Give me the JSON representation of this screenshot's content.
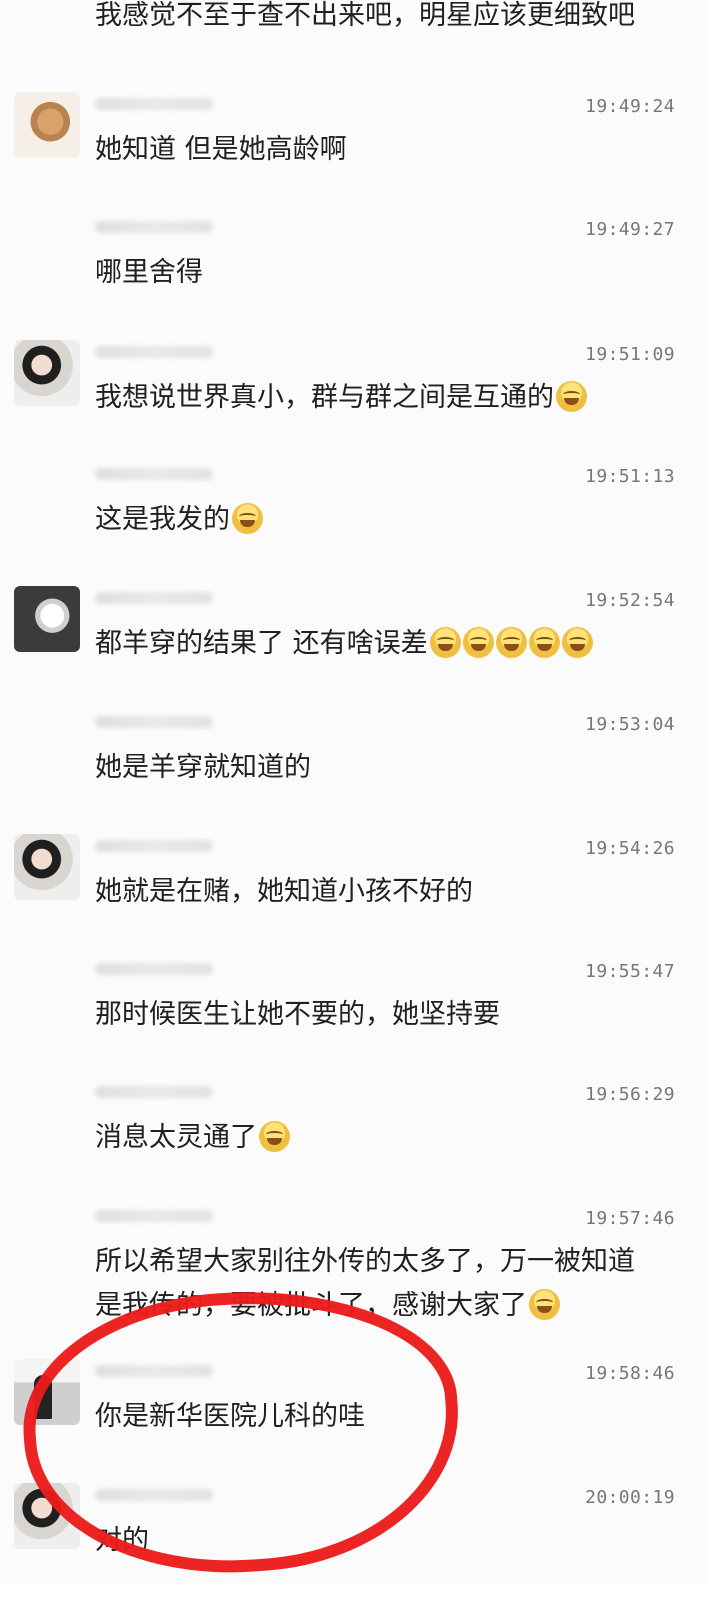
{
  "chat": {
    "top_line": "我感觉不至于查不出来吧，明星应该更细致吧",
    "messages": [
      {
        "time": "19:49:24",
        "text": "她知道 但是她高龄啊",
        "avatar": "cat"
      },
      {
        "time": "19:49:27",
        "text": "哪里舍得",
        "avatar": "blank"
      },
      {
        "time": "19:51:09",
        "text": "我想说世界真小，群与群之间是互通的",
        "avatar": "girl",
        "emoji": "laughing-tears-face"
      },
      {
        "time": "19:51:13",
        "text": "这是我发的",
        "avatar": "blank",
        "emoji": "laughing-face"
      },
      {
        "time": "19:52:54",
        "text": "都羊穿的结果了 还有啥误差",
        "avatar": "dog",
        "emoji_count": 5
      },
      {
        "time": "19:53:04",
        "text": "她是羊穿就知道的",
        "avatar": "blank"
      },
      {
        "time": "19:54:26",
        "text": "她就是在赌，她知道小孩不好的",
        "avatar": "girl"
      },
      {
        "time": "19:55:47",
        "text": "那时候医生让她不要的，她坚持要",
        "avatar": "blank"
      },
      {
        "time": "19:56:29",
        "text": "消息太灵通了",
        "avatar": "blank",
        "emoji": "laughing-face"
      },
      {
        "time": "19:57:46",
        "text": "所以希望大家别往外传的太多了，万一被知道\n是我传的，要被批斗了，感谢大家了",
        "avatar": "blank",
        "emoji": "laughing-tears-face"
      },
      {
        "time": "19:58:46",
        "text": "你是新华医院儿科的哇",
        "avatar": "hospital"
      },
      {
        "time": "20:00:19",
        "text": "对的",
        "avatar": "girl"
      }
    ]
  },
  "colors": {
    "background": "#fbfbfb",
    "text": "#202020",
    "time": "#777777",
    "highlight": "#ec1b1b"
  },
  "icons": {
    "emoji": "laughing-face-icon"
  }
}
